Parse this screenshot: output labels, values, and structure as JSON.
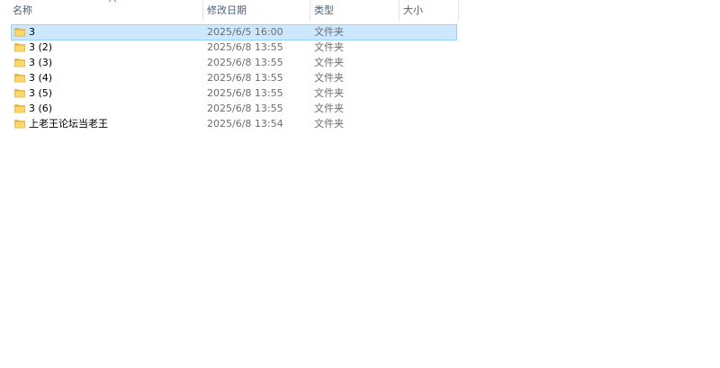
{
  "columns": {
    "name": "名称",
    "date": "修改日期",
    "type": "类型",
    "size": "大小"
  },
  "files": [
    {
      "name": "3",
      "date": "2025/6/5 16:00",
      "type": "文件夹",
      "icon": "folder-icon",
      "selected": true
    },
    {
      "name": "3 (2)",
      "date": "2025/6/8 13:55",
      "type": "文件夹",
      "icon": "folder-icon",
      "selected": false
    },
    {
      "name": "3 (3)",
      "date": "2025/6/8 13:55",
      "type": "文件夹",
      "icon": "folder-icon",
      "selected": false
    },
    {
      "name": "3 (4)",
      "date": "2025/6/8 13:55",
      "type": "文件夹",
      "icon": "folder-icon",
      "selected": false
    },
    {
      "name": "3 (5)",
      "date": "2025/6/8 13:55",
      "type": "文件夹",
      "icon": "folder-icon",
      "selected": false
    },
    {
      "name": "3 (6)",
      "date": "2025/6/8 13:55",
      "type": "文件夹",
      "icon": "folder-icon",
      "selected": false
    },
    {
      "name": "上老王论坛当老王",
      "date": "2025/6/8 13:54",
      "type": "文件夹",
      "icon": "folder-icon",
      "selected": false
    }
  ],
  "colors": {
    "selection_fill": "#cce8ff",
    "selection_border": "#99d1ff",
    "header_text": "#4c607a",
    "folder_yellow": "#ffd76a"
  }
}
